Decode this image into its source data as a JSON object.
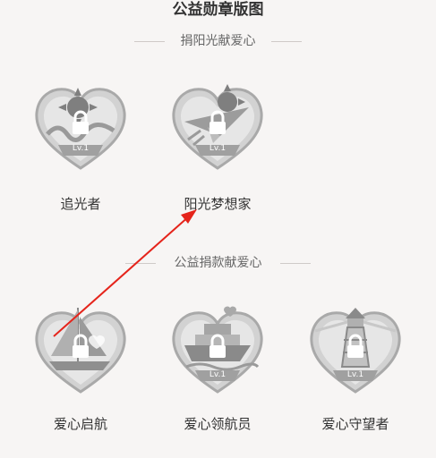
{
  "header": {
    "title": "公益勋章版图"
  },
  "sections": [
    {
      "label": "捐阳光献爱心",
      "badges": [
        {
          "name": "追光者",
          "level": "Lv.1",
          "icon": "sun-waves-icon"
        },
        {
          "name": "阳光梦想家",
          "level": "Lv.1",
          "icon": "sun-paper-plane-icon"
        }
      ]
    },
    {
      "label": "公益捐款献爱心",
      "badges": [
        {
          "name": "爱心启航",
          "level": "Lv.1",
          "icon": "sailboat-icon"
        },
        {
          "name": "爱心领航员",
          "level": "Lv.1",
          "icon": "ship-icon"
        },
        {
          "name": "爱心守望者",
          "level": "Lv.1",
          "icon": "lighthouse-icon"
        }
      ]
    }
  ],
  "colors": {
    "badge_silver": "#c9c9c9",
    "badge_dark": "#9a9a9a",
    "annotation_arrow": "#e5241b"
  }
}
